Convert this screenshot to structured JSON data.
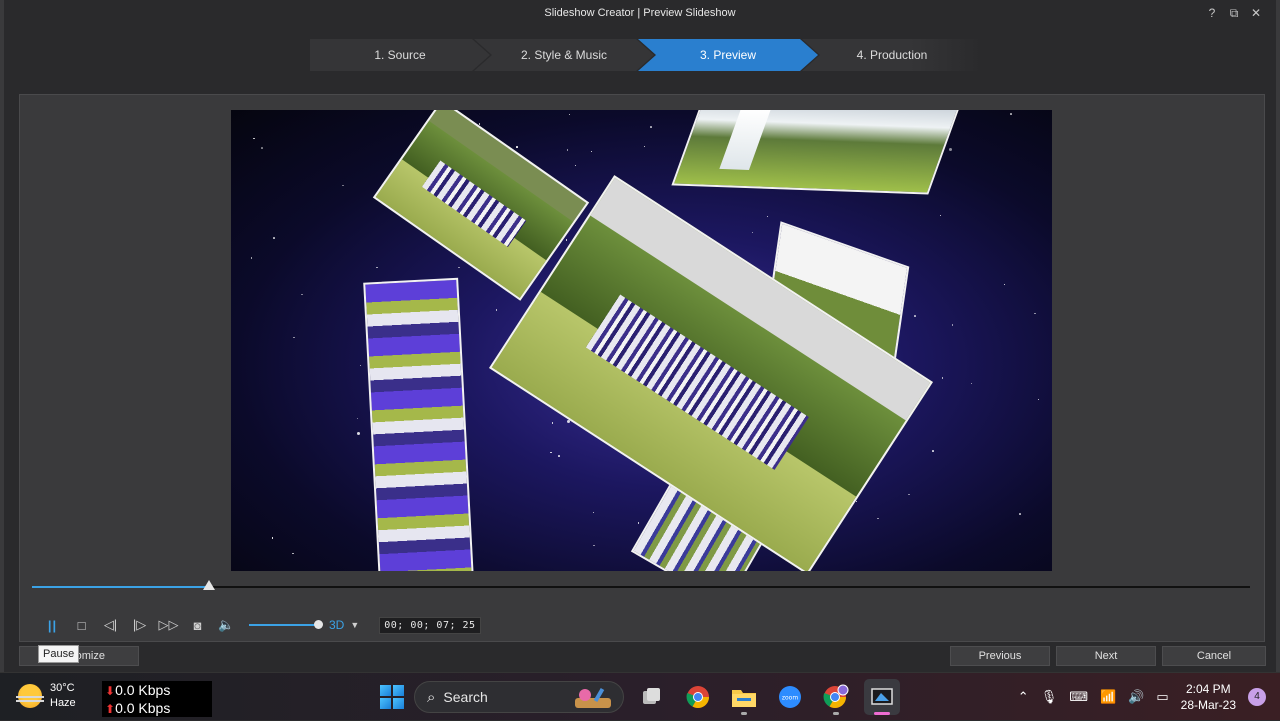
{
  "window": {
    "title": "Slideshow Creator | Preview Slideshow",
    "help_glyph": "?",
    "restore_glyph": "⧉",
    "close_glyph": "✕"
  },
  "steps": [
    {
      "label": "1. Source",
      "active": false
    },
    {
      "label": "2. Style & Music",
      "active": false
    },
    {
      "label": "3. Preview",
      "active": true
    },
    {
      "label": "4. Production",
      "active": false
    }
  ],
  "playback": {
    "progress_fraction": 0.145,
    "volume_fraction": 1.0,
    "mode": "3D",
    "timecode": "00; 00; 07; 25",
    "pause_glyph": "||",
    "stop_glyph": "□",
    "prev_frame_glyph": "◁|",
    "next_frame_glyph": "|▷",
    "fast_forward_glyph": "▷▷",
    "snapshot_glyph": "◙",
    "volume_glyph": "🔈",
    "caret_glyph": "▼"
  },
  "tooltip": {
    "text": "Pause"
  },
  "footer": {
    "customize_label": "Customize",
    "previous_label": "Previous",
    "next_label": "Next",
    "cancel_label": "Cancel"
  },
  "taskbar": {
    "temperature": "30°C",
    "condition": "Haze",
    "net_down": "0.0 Kbps",
    "net_up": "0.0 Kbps",
    "search_label": "Search",
    "time": "2:04 PM",
    "date": "28-Mar-23",
    "notification_count": "4",
    "zoom_label": "zoom"
  },
  "colors": {
    "accent": "#2a7fcf",
    "timeline": "#3ba2e6",
    "active_app_indicator": "#f06cd2"
  }
}
